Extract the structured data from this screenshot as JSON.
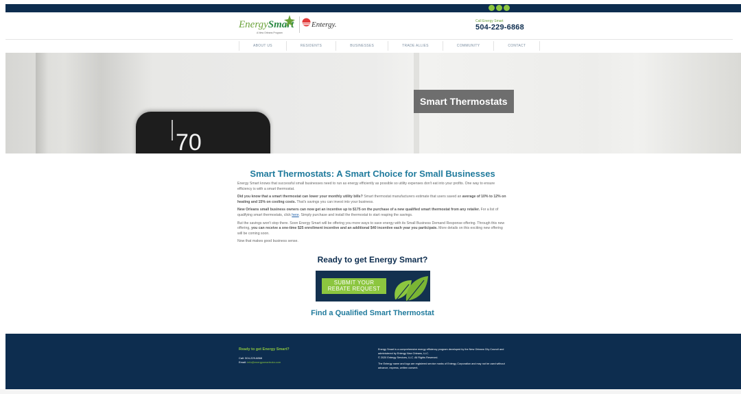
{
  "header": {
    "logo_word_1": "Energy",
    "logo_word_2": "Smart",
    "logo_tagline": "A New Orleans Program",
    "partner_logo": "Entergy.",
    "call_label": "Call Energy Smart",
    "phone": "504-229-6868"
  },
  "nav": {
    "items": [
      "ABOUT US",
      "RESIDENTS",
      "BUSINESSES",
      "TRADE ALLIES",
      "COMMUNITY",
      "CONTACT"
    ]
  },
  "hero": {
    "badge": "Smart Thermostats",
    "thermostat_reading": "70"
  },
  "content": {
    "title": "Smart Thermostats: A Smart Choice for Small Businesses",
    "p1": "Energy Smart knows that successful small businesses need to run as energy efficiently as possible so utility expenses don't eat into your profits. One way to ensure efficiency is with a smart thermostat.",
    "p2_bold": "Did you know that a smart thermostat can lower your monthly utility bills?",
    "p2_a": " Smart thermostat manufacturers estimate that users saved an ",
    "p2_bold2": "average of 10% to 12% on heating and 15% on cooling costs.",
    "p2_b": " That's savings you can invest into your business.",
    "p3_bold": "New Orleans small business owners can now get an incentive up to $175 on the purchase of a new qualified smart thermostat from any retailer.",
    "p3_a": " For a list of qualifying smart thermostats, click ",
    "p3_link": "here",
    "p3_b": ". Simply purchase and install the thermostat to start reaping the savings.",
    "p4_a": "But the savings won't stop there. Soon Energy Smart will be offering you more ways to save energy with its Small Business Demand Response offering. Through this new offering, ",
    "p4_bold": "you can receive a one-time $25 enrollment incentive and an additional $40 incentive each year you participate.",
    "p4_b": " More details on this exciting new offering will be coming soon.",
    "p5": "Now that makes good business sense.",
    "ready": "Ready to get Energy Smart?",
    "rebate_button": "SUBMIT YOUR REBATE REQUEST",
    "find": "Find a Qualified Smart Thermostat"
  },
  "footer": {
    "left_title": "Ready to get Energy Smart?",
    "call": "Call: 504-229-6868",
    "email_label": "Email: ",
    "email": "info@energysmartnola.com",
    "right_1": "Energy Smart is a comprehensive energy efficiency program developed by the New Orleans City Council and administered by Entergy New Orleans, LLC.",
    "right_2": "© 2020 Entergy Services, LLC. All Rights Reserved.",
    "right_3": "The Entergy name and logo are registered service marks of Entergy Corporation and may not be used without advance, express, written consent."
  },
  "colors": {
    "navy": "#0d2d4f",
    "green": "#8cc63f",
    "teal_heading": "#1f7a9c"
  },
  "icons": [
    "facebook-icon",
    "twitter-icon",
    "instagram-icon",
    "leaf-icon"
  ]
}
